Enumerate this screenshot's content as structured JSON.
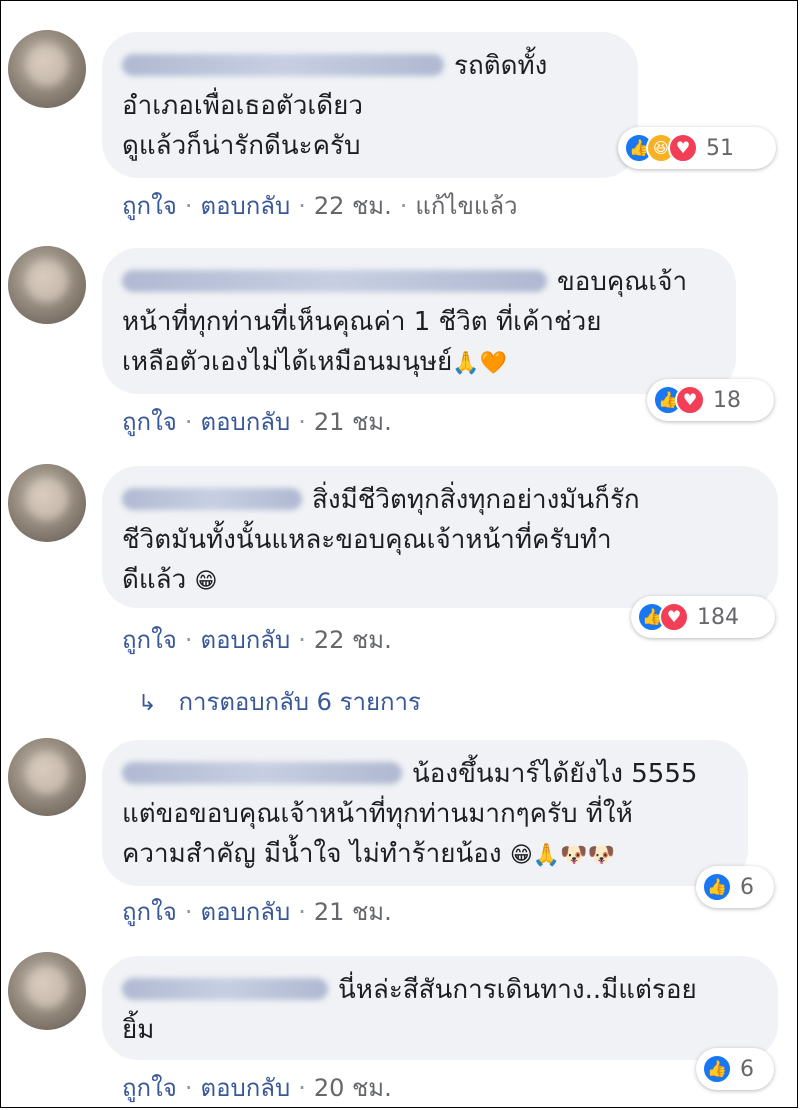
{
  "comments": [
    {
      "text_lines": [
        "รถติดทั้ง",
        "อำเภอเพื่อเธอตัวเดียว",
        "ดูแล้วก็น่ารักดีนะครับ"
      ],
      "reaction_count": "51",
      "like_label": "ถูกใจ",
      "reply_label": "ตอบกลับ",
      "time": "22 ชม.",
      "edited": "แก้ไขแล้ว"
    },
    {
      "text_lines": [
        "ขอบคุณเจ้า",
        "หน้าที่ทุกท่านที่เห็นคุณค่า 1 ชีวิต ที่เค้าช่วย",
        "เหลือตัวเองไม่ได้เหมือนมนุษย์"
      ],
      "emoji_tail": "🙏🧡",
      "reaction_count": "18",
      "like_label": "ถูกใจ",
      "reply_label": "ตอบกลับ",
      "time": "21 ชม."
    },
    {
      "text_lines": [
        "สิ่งมีชีวิตทุกสิ่งทุกอย่างมันก็รัก",
        "ชีวิตมันทั้งนั้นแหละขอบคุณเจ้าหน้าที่ครับทำ",
        "ดีแล้ว"
      ],
      "emoji_tail": "😁",
      "reaction_count": "184",
      "like_label": "ถูกใจ",
      "reply_label": "ตอบกลับ",
      "time": "22 ชม."
    },
    {
      "text_lines": [
        "น้องขึ้นมาร์ได้ยังไง 5555",
        "แต่ขอขอบคุณเจ้าหน้าที่ทุกท่านมากๆครับ ที่ให้",
        "ความสำคัญ มีน้ำใจ ไม่ทำร้ายน้อง"
      ],
      "emoji_tail": "😁🙏🐶🐶",
      "reaction_count": "6",
      "like_label": "ถูกใจ",
      "reply_label": "ตอบกลับ",
      "time": "21 ชม."
    },
    {
      "text_lines": [
        "นี่หล่ะสีสันการเดินทาง..มีแต่รอย",
        "ยิ้ม"
      ],
      "reaction_count": "6",
      "like_label": "ถูกใจ",
      "reply_label": "ตอบกลับ",
      "time": "20 ชม."
    }
  ],
  "replies_link": "การตอบกลับ 6 รายการ",
  "icons": {
    "like": "like-icon",
    "haha": "haha-icon",
    "love": "love-icon",
    "reply_arrow": "reply-arrow-icon"
  },
  "colors": {
    "link": "#385898",
    "bubble": "#f0f2f5",
    "like": "#1877f2",
    "love": "#f33e58",
    "haha": "#f7b125"
  }
}
